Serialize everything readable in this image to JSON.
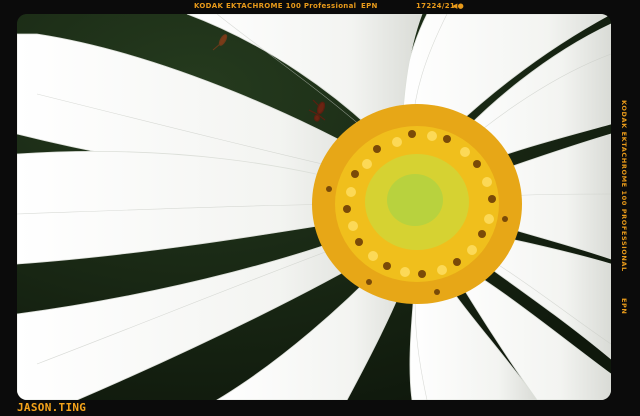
{
  "film_edge": {
    "top_film_name": "KODAK EKTACHROME 100 Professional",
    "top_code": "EPN",
    "top_frame": "17224/21",
    "top_arrow_icon": "film-arrow-icon",
    "side_film_name": "KODAK EKTACHROME 100 PROFESSIONAL",
    "side_code": "EPN",
    "ink_color": "#e89a1a"
  },
  "watermark": {
    "text": "JASON.TING",
    "color": "#f4a31a"
  },
  "photo": {
    "subject": "white-daisy-flower",
    "petal_color": "#f6f7f4",
    "center_color": "#f2c21a",
    "disc_color": "#cfd83a",
    "background_color": "#1a2a14"
  }
}
